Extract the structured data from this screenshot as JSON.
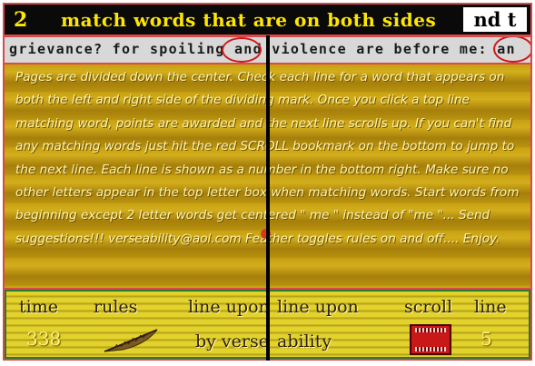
{
  "header": {
    "level": "2",
    "title": "match words that are on both sides",
    "letter_box": "nd t"
  },
  "top_line": {
    "text": "grievance? for spoiling and violence are before me: an"
  },
  "rules": {
    "text": "Pages are divided down the center. Check each line for a word that appears on both the left and right side of the dividing mark. Once you click a top line matching word, points are awarded and the next line scrolls up. If you can't find any matching words just hit the red SCROLL bookmark on the bottom to jump to the next line. Each line is shown as a number in the bottom right. Make sure no other letters appear in the top letter box when matching words. Start words from beginning except 2 letter words get centered \" me \" instead of \"me \"... Send suggestions!!! verseability@aol.com Feather toggles rules on and off.... Enjoy."
  },
  "status": {
    "time_label": "time",
    "time_value": "338",
    "rules_label": "rules",
    "banner_left_1": "line upon",
    "banner_right_1": "line upon",
    "banner_left_2": "by verse",
    "banner_right_2": "ability",
    "scroll_label": "scroll",
    "line_label": "line",
    "line_value": "5"
  },
  "icons": {
    "feather": "feather-icon",
    "scroll_bookmark": "red-bookmark-icon"
  },
  "colors": {
    "title_text": "#ffe600",
    "frame": "#d94a4a",
    "circle": "#d01818",
    "scroll_button": "#c81818"
  }
}
